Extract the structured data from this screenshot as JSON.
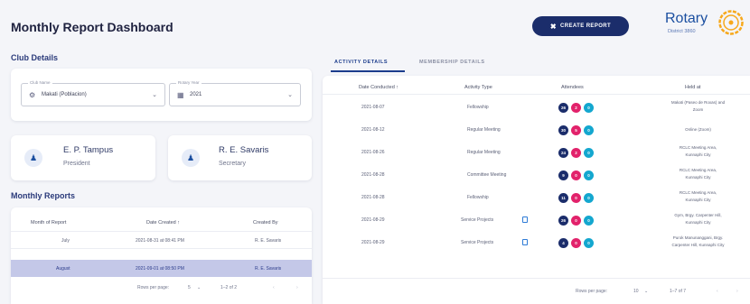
{
  "header": {
    "title": "Monthly Report Dashboard",
    "create_button": "CREATE REPORT"
  },
  "logo": {
    "word": "Rotary",
    "district": "District 3860"
  },
  "club_details": {
    "label": "Club Details",
    "club_field": {
      "legend": "Club Name",
      "value": "Makati (Poblacion)"
    },
    "year_field": {
      "legend": "Rotary Year",
      "value": "2021"
    },
    "officers": [
      {
        "name": "E. P. Tampus",
        "role": "President"
      },
      {
        "name": "R. E. Savaris",
        "role": "Secretary"
      }
    ]
  },
  "monthly_reports": {
    "label": "Monthly Reports",
    "columns": [
      "Month of Report",
      "Date Created ↑",
      "Created By"
    ],
    "rows": [
      {
        "month": "July",
        "date": "2021-08-31 at 08:41 PM",
        "by": "R. E. Savaris"
      },
      {
        "month": "August",
        "date": "2021-09-01 at 08:50 PM",
        "by": "R. E. Savaris"
      }
    ],
    "pager": {
      "rows_label": "Rows per page:",
      "rows_value": "5",
      "range": "1–2 of 2"
    }
  },
  "activities": {
    "tabs": [
      "ACTIVITY DETAILS",
      "MEMBERSHIP DETAILS"
    ],
    "columns": [
      "Date Conducted ↑",
      "Activity Type",
      "Attendees",
      "Held at"
    ],
    "rows": [
      {
        "date": "2021-08-07",
        "type": "Fellowship",
        "counts": [
          "26",
          "2",
          "0"
        ],
        "doc": false,
        "place": [
          "Makati (Paseo de Roxas) and",
          "Zoom"
        ]
      },
      {
        "date": "2021-08-12",
        "type": "Regular Meeting",
        "counts": [
          "30",
          "5",
          "0"
        ],
        "doc": false,
        "place": [
          "Online (Zoom)"
        ]
      },
      {
        "date": "2021-08-26",
        "type": "Regular Meeting",
        "counts": [
          "24",
          "2",
          "0"
        ],
        "doc": false,
        "place": [
          "RCLC Meeting Area,",
          "Kunnaphi City"
        ]
      },
      {
        "date": "2021-08-28",
        "type": "Committee Meeting",
        "counts": [
          "9",
          "0",
          "0"
        ],
        "doc": false,
        "place": [
          "RCLC Meeting Area,",
          "Kunnaphi City"
        ]
      },
      {
        "date": "2021-08-28",
        "type": "Fellowship",
        "counts": [
          "11",
          "0",
          "0"
        ],
        "doc": false,
        "place": [
          "RCLC Meeting Area,",
          "Kunnaphi City"
        ]
      },
      {
        "date": "2021-08-29",
        "type": "Service Projects",
        "counts": [
          "26",
          "0",
          "0"
        ],
        "doc": true,
        "place": [
          "Gym, Brgy. Carpenter Hill,",
          "Kunnaphi City"
        ]
      },
      {
        "date": "2021-08-29",
        "type": "Service Projects",
        "counts": [
          "4",
          "0",
          "0"
        ],
        "doc": true,
        "place": [
          "Purok Manunanggani, Brgy.",
          "Carpenter Hill, Kunnaphi City"
        ]
      }
    ],
    "pager": {
      "rows_label": "Rows per page:",
      "rows_value": "10",
      "range": "1–7 of 7"
    }
  }
}
